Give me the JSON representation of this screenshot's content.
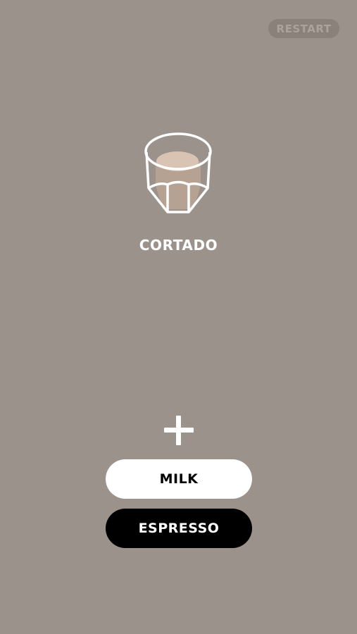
{
  "header": {
    "restart_label": "RESTART"
  },
  "drink": {
    "name": "CORTADO",
    "icon": "cortado-glass-icon"
  },
  "add_icon": "plus-icon",
  "options": {
    "milk_label": "MILK",
    "espresso_label": "ESPRESSO"
  },
  "colors": {
    "background": "#9b928b",
    "restart_bg": "#8a817b",
    "restart_text": "#aaa29b",
    "milk_button": "#ffffff",
    "espresso_button": "#000000",
    "coffee_fill": "#bba593",
    "foam": "#d9c4b4"
  }
}
